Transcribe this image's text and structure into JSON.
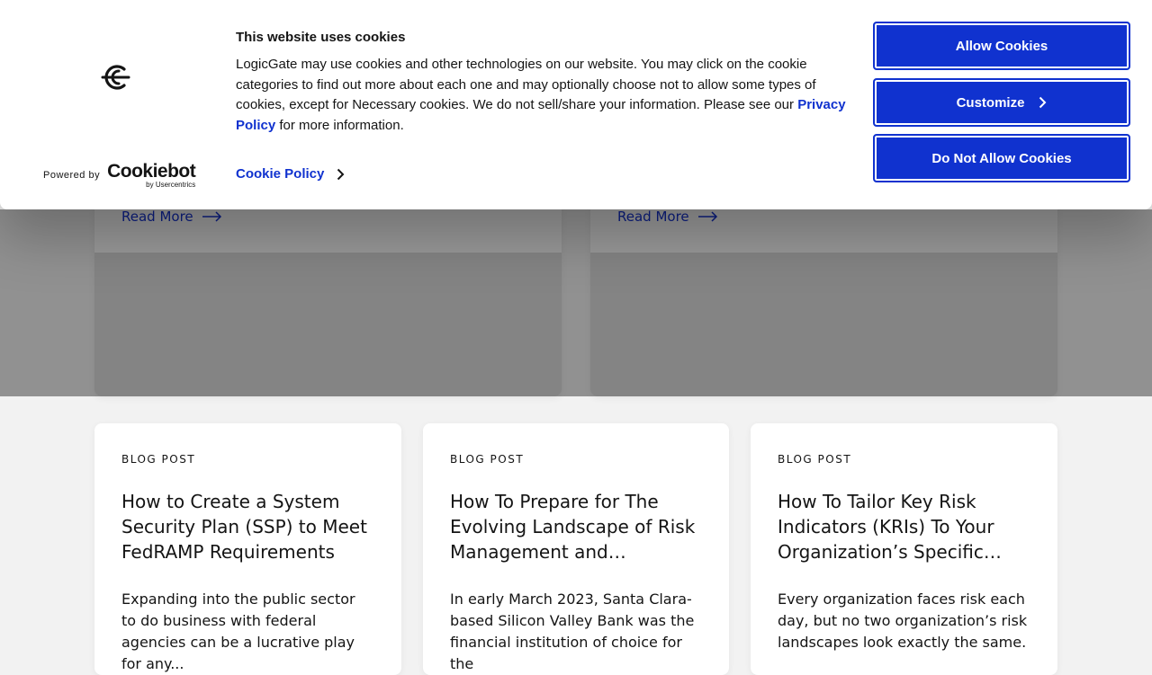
{
  "cookie_banner": {
    "title": "This website uses cookies",
    "text_before_link": "LogicGate may use cookies and other technologies on our website. You may click on the cookie categories to find out more about each one and may optionally choose not to allow some types of cookies, except for Necessary cookies.  We do not sell/share your information. Please see our ",
    "privacy_link_label": "Privacy Policy",
    "text_after_link": " for more information.",
    "cookie_policy_label": "Cookie Policy",
    "powered_by": "Powered by",
    "cookiebot_name": "Cookiebot",
    "cookiebot_sub": "by Usercentrics",
    "buttons": {
      "allow": "Allow Cookies",
      "customize": "Customize",
      "deny": "Do Not Allow Cookies"
    },
    "colors": {
      "accent": "#1032cf"
    }
  },
  "featured": [
    {
      "read_more": "Read More"
    },
    {
      "read_more": "Read More"
    }
  ],
  "posts": [
    {
      "kicker": "BLOG POST",
      "title": "How to Create a System Security Plan (SSP) to Meet FedRAMP Requirements",
      "excerpt": "Expanding into the public sector to do business with federal agencies can be a lucrative play for any..."
    },
    {
      "kicker": "BLOG POST",
      "title": "How To Prepare for The Evolving Landscape of Risk Management and Regulatory Compliance",
      "excerpt": "In early March 2023, Santa Clara-based Silicon Valley Bank was the financial institution of choice for the"
    },
    {
      "kicker": "BLOG POST",
      "title": "How To Tailor Key Risk Indicators (KRIs) To Your Organization’s Specific Needs",
      "excerpt": "Every organization faces risk each day, but no two organization’s risk landscapes look exactly the same."
    }
  ]
}
